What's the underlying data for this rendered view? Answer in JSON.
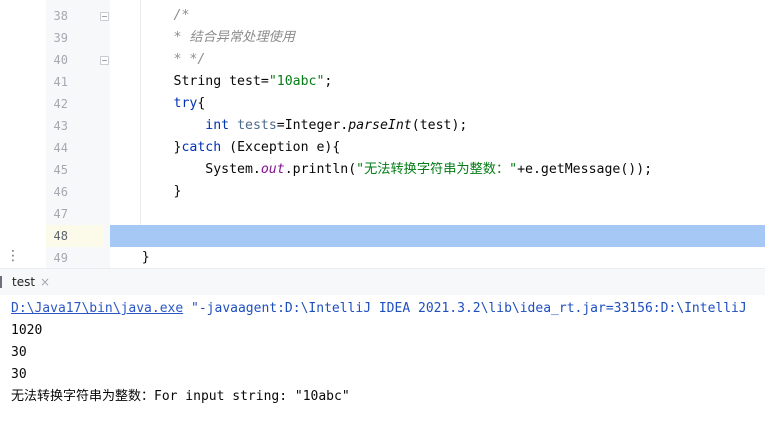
{
  "editor": {
    "line_numbers": [
      "38",
      "39",
      "40",
      "41",
      "42",
      "43",
      "44",
      "45",
      "46",
      "47",
      "48",
      "49"
    ],
    "current_line_index": 10,
    "code": {
      "l38": "/*",
      "l39": "* 结合异常处理使用",
      "l40": "* */",
      "l41_type": "String",
      "l41_name": " test=",
      "l41_str": "\"10abc\"",
      "l41_end": ";",
      "l42_kw": "try",
      "l42_end": "{",
      "l43_kw": "int",
      "l43_var": "tests",
      "l43_a": "=Integer.",
      "l43_method": "parseInt",
      "l43_b": "(test);",
      "l44_a": "}",
      "l44_kw": "catch",
      "l44_b": " (Exception e){",
      "l45_a": "System.",
      "l45_field": "out",
      "l45_b": ".println(",
      "l45_str": "\"无法转换字符串为整数：\"",
      "l45_c": "+e.getMessage());",
      "l46": "}",
      "l49": "}"
    }
  },
  "run_panel": {
    "tab_label": "test",
    "tab_close": "×"
  },
  "console": {
    "cmd_path": "D:\\Java17\\bin\\java.exe",
    "cmd_rest": " \"-javaagent:D:\\IntelliJ IDEA 2021.3.2\\lib\\idea_rt.jar=33156:D:\\IntelliJ",
    "out1": "1020",
    "out2": "30",
    "out3": "30",
    "out4": "无法转换字符串为整数：For input string: \"10abc\""
  },
  "icons": {
    "more": "⋮"
  },
  "colors": {
    "keyword": "#0033b3",
    "string": "#067d17",
    "comment": "#8c8c8c",
    "static_field": "#871094",
    "selection": "#a6c8f5",
    "link": "#2a56c6"
  }
}
